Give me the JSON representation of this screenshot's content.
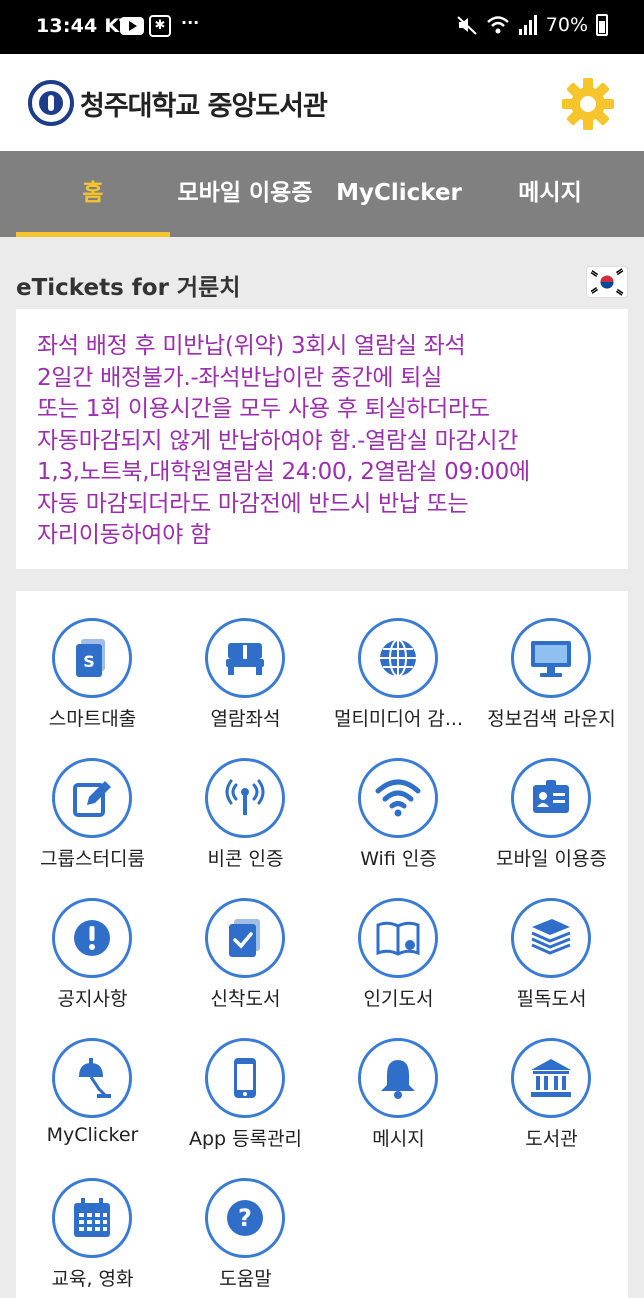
{
  "status_bar": {
    "time": "13:44",
    "carrier": "KT",
    "dots": "···",
    "battery": "70%"
  },
  "header": {
    "title": "청주대학교 중앙도서관"
  },
  "tabs": [
    {
      "label": "홈",
      "active": true
    },
    {
      "label": "모바일 이용증",
      "active": false
    },
    {
      "label": "MyClicker",
      "active": false
    },
    {
      "label": "메시지",
      "active": false
    }
  ],
  "etickets": {
    "title": "eTickets for 거룬치",
    "notice": "좌석 배정 후 미반납(위약) 3회시 열람실 좌석\n2일간 배정불가.-좌석반납이란 중간에 퇴실\n또는 1회 이용시간을 모두 사용 후 퇴실하더라도\n자동마감되지 않게 반납하여야 함.-열람실 마감시간\n1,3,노트북,대학원열람실 24:00, 2열람실 09:00에\n자동 마감되더라도 마감전에 반드시 반납 또는\n자리이동하여야 함"
  },
  "menu": [
    {
      "label": "스마트대출",
      "icon": "smart-loan-icon"
    },
    {
      "label": "열람좌석",
      "icon": "seat-icon"
    },
    {
      "label": "멀티미디어 감...",
      "icon": "globe-icon"
    },
    {
      "label": "정보검색 라운지",
      "icon": "monitor-icon"
    },
    {
      "label": "그룹스터디룸",
      "icon": "edit-icon"
    },
    {
      "label": "비콘 인증",
      "icon": "beacon-icon"
    },
    {
      "label": "Wifi 인증",
      "icon": "wifi-icon"
    },
    {
      "label": "모바일 이용증",
      "icon": "id-card-icon"
    },
    {
      "label": "공지사항",
      "icon": "alert-icon"
    },
    {
      "label": "신착도서",
      "icon": "new-book-icon"
    },
    {
      "label": "인기도서",
      "icon": "open-book-icon"
    },
    {
      "label": "필독도서",
      "icon": "book-stack-icon"
    },
    {
      "label": "MyClicker",
      "icon": "lamp-icon"
    },
    {
      "label": "App 등록관리",
      "icon": "phone-icon"
    },
    {
      "label": "메시지",
      "icon": "bell-icon"
    },
    {
      "label": "도서관",
      "icon": "building-icon"
    },
    {
      "label": "교육, 영화",
      "icon": "calendar-icon"
    },
    {
      "label": "도움말",
      "icon": "help-icon"
    }
  ],
  "colors": {
    "accent": "#f6c42b",
    "icon_blue": "#2f6fc9",
    "notice_text": "#9b2fae",
    "tab_bar": "#808080"
  }
}
